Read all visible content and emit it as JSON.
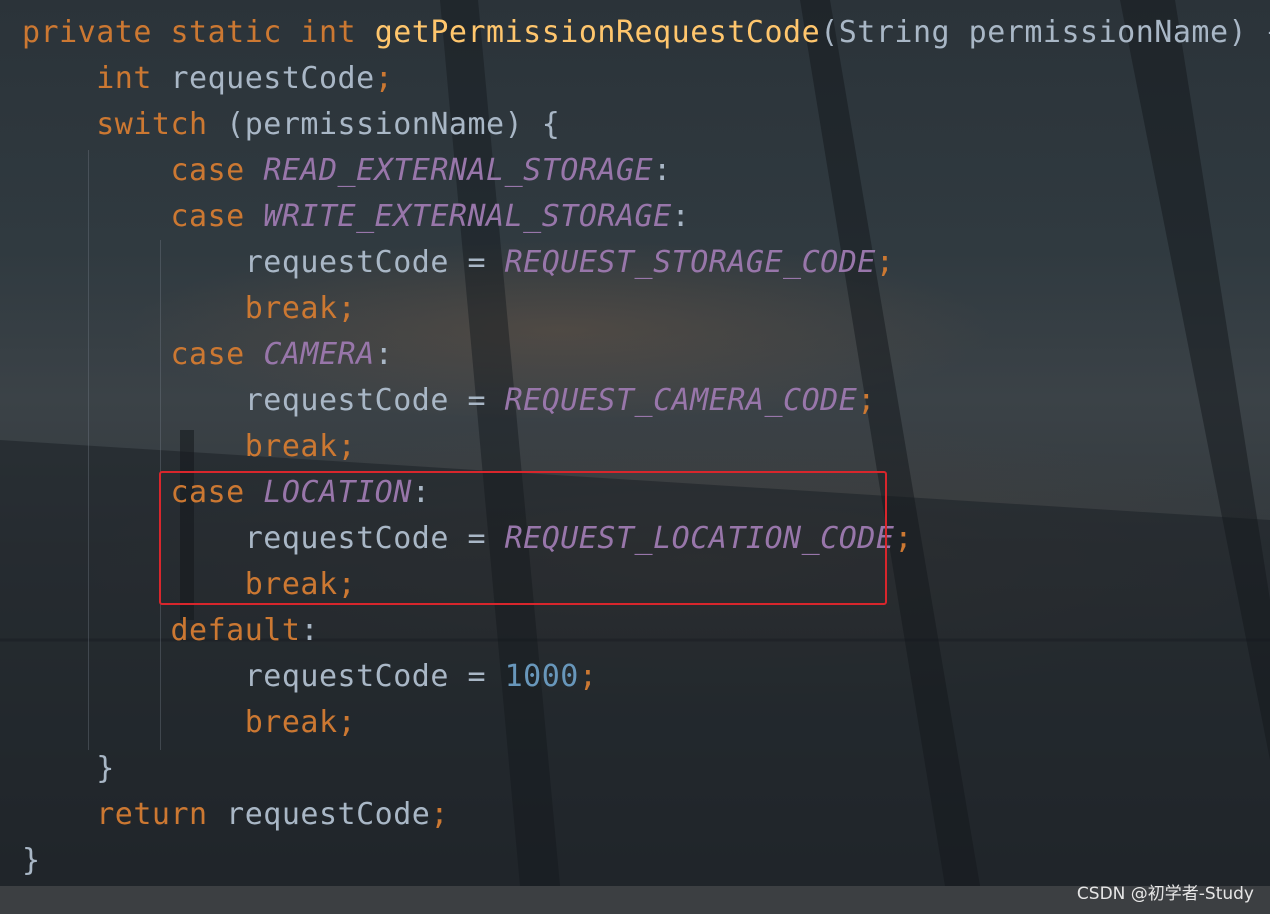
{
  "editor": {
    "lines": [
      [
        {
          "t": "private",
          "c": "kw"
        },
        {
          "t": " "
        },
        {
          "t": "static",
          "c": "kw"
        },
        {
          "t": " "
        },
        {
          "t": "int",
          "c": "kw"
        },
        {
          "t": " "
        },
        {
          "t": "getPermissionRequestCode",
          "c": "fn"
        },
        {
          "t": "(String permissionName) {"
        }
      ],
      [
        {
          "t": "    "
        },
        {
          "t": "int",
          "c": "kw"
        },
        {
          "t": " requestCode"
        },
        {
          "t": ";",
          "c": "semi"
        }
      ],
      [
        {
          "t": "    "
        },
        {
          "t": "switch",
          "c": "kw"
        },
        {
          "t": " (permissionName) {"
        }
      ],
      [
        {
          "t": "        "
        },
        {
          "t": "case",
          "c": "kw"
        },
        {
          "t": " "
        },
        {
          "t": "READ_EXTERNAL_STORAGE",
          "c": "cst"
        },
        {
          "t": ":"
        }
      ],
      [
        {
          "t": "        "
        },
        {
          "t": "case",
          "c": "kw"
        },
        {
          "t": " "
        },
        {
          "t": "WRITE_EXTERNAL_STORAGE",
          "c": "cst"
        },
        {
          "t": ":"
        }
      ],
      [
        {
          "t": "            requestCode = "
        },
        {
          "t": "REQUEST_STORAGE_CODE",
          "c": "cst"
        },
        {
          "t": ";",
          "c": "semi"
        }
      ],
      [
        {
          "t": "            "
        },
        {
          "t": "break",
          "c": "kw"
        },
        {
          "t": ";",
          "c": "semi"
        }
      ],
      [
        {
          "t": "        "
        },
        {
          "t": "case",
          "c": "kw"
        },
        {
          "t": " "
        },
        {
          "t": "CAMERA",
          "c": "cst"
        },
        {
          "t": ":"
        }
      ],
      [
        {
          "t": "            requestCode = "
        },
        {
          "t": "REQUEST_CAMERA_CODE",
          "c": "cst"
        },
        {
          "t": ";",
          "c": "semi"
        }
      ],
      [
        {
          "t": "            "
        },
        {
          "t": "break",
          "c": "kw"
        },
        {
          "t": ";",
          "c": "semi"
        }
      ],
      [
        {
          "t": "        "
        },
        {
          "t": "case",
          "c": "kw"
        },
        {
          "t": " "
        },
        {
          "t": "LOCATION",
          "c": "cst"
        },
        {
          "t": ":"
        }
      ],
      [
        {
          "t": "            requestCode = "
        },
        {
          "t": "REQUEST_LOCATION_CODE",
          "c": "cst"
        },
        {
          "t": ";",
          "c": "semi"
        }
      ],
      [
        {
          "t": "            "
        },
        {
          "t": "break",
          "c": "kw"
        },
        {
          "t": ";",
          "c": "semi"
        }
      ],
      [
        {
          "t": "        "
        },
        {
          "t": "default",
          "c": "kw"
        },
        {
          "t": ":"
        }
      ],
      [
        {
          "t": "            requestCode = "
        },
        {
          "t": "1000",
          "c": "num"
        },
        {
          "t": ";",
          "c": "semi"
        }
      ],
      [
        {
          "t": "            "
        },
        {
          "t": "break",
          "c": "kw"
        },
        {
          "t": ";",
          "c": "semi"
        }
      ],
      [
        {
          "t": "    }"
        }
      ],
      [
        {
          "t": "    "
        },
        {
          "t": "return",
          "c": "kw"
        },
        {
          "t": " requestCode"
        },
        {
          "t": ";",
          "c": "semi"
        }
      ],
      [
        {
          "t": "}"
        }
      ]
    ],
    "highlighted_lines": [
      10,
      11,
      12
    ],
    "colors": {
      "keyword": "#cc7832",
      "method": "#ffc66d",
      "constant": "#9876aa",
      "number": "#6897bb",
      "plain": "#a9b7c6",
      "highlight_border": "#d8262c"
    }
  },
  "watermark": "CSDN @初学者-Study"
}
